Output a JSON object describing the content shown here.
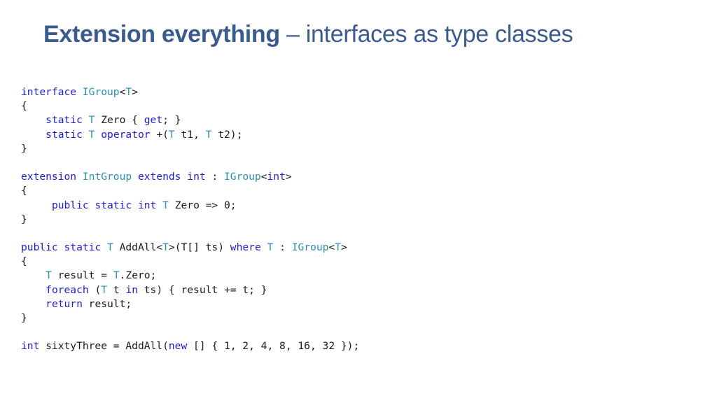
{
  "slide": {
    "title_bold": "Extension everything",
    "title_rest": " – interfaces as type classes"
  },
  "colors": {
    "title": "#3b5b8e",
    "keyword": "#1d1dd0",
    "type": "#2b91af",
    "text": "#1a1a1a"
  },
  "code": {
    "lines": [
      [
        [
          "kw",
          "interface"
        ],
        [
          "tx",
          " "
        ],
        [
          "ty",
          "IGroup"
        ],
        [
          "tx",
          "<"
        ],
        [
          "ty",
          "T"
        ],
        [
          "tx",
          ">"
        ]
      ],
      [
        [
          "tx",
          "{"
        ]
      ],
      [
        [
          "tx",
          "    "
        ],
        [
          "kw",
          "static"
        ],
        [
          "tx",
          " "
        ],
        [
          "ty",
          "T"
        ],
        [
          "tx",
          " Zero { "
        ],
        [
          "kw",
          "get"
        ],
        [
          "tx",
          "; }"
        ]
      ],
      [
        [
          "tx",
          "    "
        ],
        [
          "kw",
          "static"
        ],
        [
          "tx",
          " "
        ],
        [
          "ty",
          "T"
        ],
        [
          "tx",
          " "
        ],
        [
          "kw",
          "operator"
        ],
        [
          "tx",
          " +("
        ],
        [
          "ty",
          "T"
        ],
        [
          "tx",
          " t1, "
        ],
        [
          "ty",
          "T"
        ],
        [
          "tx",
          " t2);"
        ]
      ],
      [
        [
          "tx",
          "}"
        ]
      ],
      [],
      [
        [
          "kw",
          "extension"
        ],
        [
          "tx",
          " "
        ],
        [
          "ty",
          "IntGroup"
        ],
        [
          "tx",
          " "
        ],
        [
          "kw",
          "extends"
        ],
        [
          "tx",
          " "
        ],
        [
          "kw",
          "int"
        ],
        [
          "tx",
          " : "
        ],
        [
          "ty",
          "IGroup"
        ],
        [
          "tx",
          "<"
        ],
        [
          "kw",
          "int"
        ],
        [
          "tx",
          ">"
        ]
      ],
      [
        [
          "tx",
          "{"
        ]
      ],
      [
        [
          "tx",
          "     "
        ],
        [
          "kw",
          "public"
        ],
        [
          "tx",
          " "
        ],
        [
          "kw",
          "static"
        ],
        [
          "tx",
          " "
        ],
        [
          "kw",
          "int"
        ],
        [
          "tx",
          " "
        ],
        [
          "ty",
          "T"
        ],
        [
          "tx",
          " Zero => 0;"
        ]
      ],
      [
        [
          "tx",
          "}"
        ]
      ],
      [],
      [
        [
          "kw",
          "public"
        ],
        [
          "tx",
          " "
        ],
        [
          "kw",
          "static"
        ],
        [
          "tx",
          " "
        ],
        [
          "ty",
          "T"
        ],
        [
          "tx",
          " AddAll<"
        ],
        [
          "ty",
          "T"
        ],
        [
          "tx",
          ">(T[] ts) "
        ],
        [
          "kw",
          "where"
        ],
        [
          "tx",
          " "
        ],
        [
          "ty",
          "T"
        ],
        [
          "tx",
          " : "
        ],
        [
          "ty",
          "IGroup"
        ],
        [
          "tx",
          "<"
        ],
        [
          "ty",
          "T"
        ],
        [
          "tx",
          ">"
        ]
      ],
      [
        [
          "tx",
          "{"
        ]
      ],
      [
        [
          "tx",
          "    "
        ],
        [
          "ty",
          "T"
        ],
        [
          "tx",
          " result = "
        ],
        [
          "ty",
          "T"
        ],
        [
          "tx",
          ".Zero;"
        ]
      ],
      [
        [
          "tx",
          "    "
        ],
        [
          "kw",
          "foreach"
        ],
        [
          "tx",
          " ("
        ],
        [
          "ty",
          "T"
        ],
        [
          "tx",
          " t "
        ],
        [
          "kw",
          "in"
        ],
        [
          "tx",
          " ts) { result += t; }"
        ]
      ],
      [
        [
          "tx",
          "    "
        ],
        [
          "kw",
          "return"
        ],
        [
          "tx",
          " result;"
        ]
      ],
      [
        [
          "tx",
          "}"
        ]
      ],
      [],
      [
        [
          "kw",
          "int"
        ],
        [
          "tx",
          " sixtyThree = AddAll("
        ],
        [
          "kw",
          "new"
        ],
        [
          "tx",
          " [] { 1, 2, 4, 8, 16, 32 });"
        ]
      ]
    ]
  }
}
